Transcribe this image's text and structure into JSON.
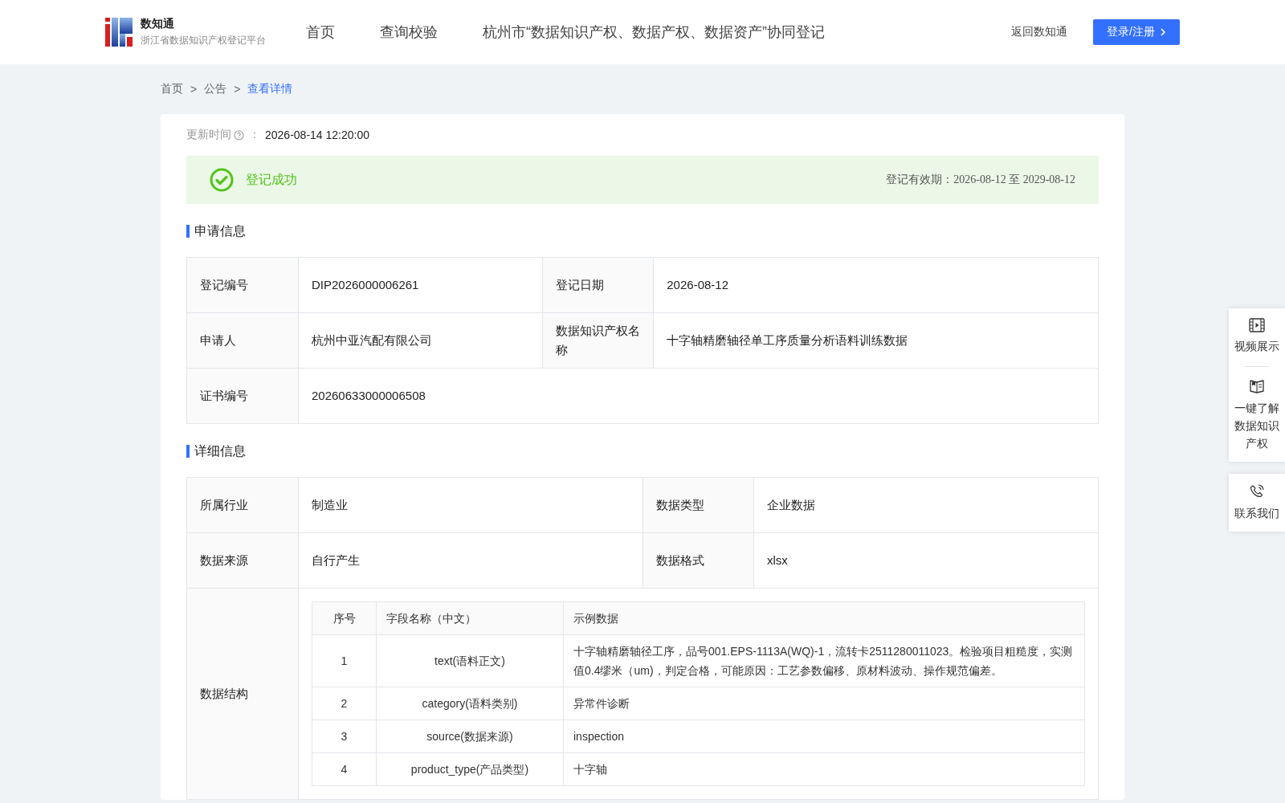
{
  "header": {
    "logo_title": "数知通",
    "logo_subtitle": "浙江省数据知识产权登记平台",
    "nav": [
      {
        "label": "首页",
        "selected": false
      },
      {
        "label": "查询校验",
        "selected": false
      },
      {
        "label": "杭州市“数据知识产权、数据产权、数据资产”协同登记",
        "selected": false
      }
    ],
    "back_link": "返回数知通",
    "login_button": "登录/注册"
  },
  "breadcrumb": [
    {
      "label": "首页",
      "selected": false
    },
    {
      "label": "公告",
      "selected": false
    },
    {
      "label": "查看详情",
      "selected": true
    }
  ],
  "breadcrumb_separator": ">",
  "update_time": {
    "label": "更新时间",
    "separator": "：",
    "value": "2026-08-14 12:20:00"
  },
  "status": {
    "kind": "success",
    "text": "登记成功",
    "validity": "登记有效期：2026-08-12 至 2029-08-12"
  },
  "application_info": {
    "title": "申请信息",
    "rows": [
      [
        {
          "label": "登记编号",
          "value": "DIP2026000006261"
        },
        {
          "label": "登记日期",
          "value": "2026-08-12"
        }
      ],
      [
        {
          "label": "申请人",
          "value": "杭州中亚汽配有限公司"
        },
        {
          "label": "数据知识产权名称",
          "value": "十字轴精磨轴径单工序质量分析语料训练数据"
        }
      ],
      [
        {
          "label": "证书编号",
          "value": "20260633000006508"
        }
      ]
    ]
  },
  "detail_info": {
    "title": "详细信息",
    "rows": [
      [
        {
          "label": "所属行业",
          "value": "制造业"
        },
        {
          "label": "数据类型",
          "value": "企业数据"
        }
      ],
      [
        {
          "label": "数据来源",
          "value": "自行产生"
        },
        {
          "label": "数据格式",
          "value": "xlsx"
        }
      ]
    ],
    "structure": {
      "label": "数据结构",
      "columns": [
        "序号",
        "字段名称（中文）",
        "示例数据"
      ],
      "rows": [
        [
          "1",
          "text(语料正文)",
          "十字轴精磨轴径工序，品号001.EPS-1113A(WQ)-1，流转卡2511280011023。检验项目粗糙度，实测值0.4缪米（um)，判定合格，可能原因：工艺参数偏移、原材料波动、操作规范偏差。"
        ],
        [
          "2",
          "category(语料类别)",
          "异常件诊断"
        ],
        [
          "3",
          "source(数据来源)",
          "inspection"
        ],
        [
          "4",
          "product_type(产品类型)",
          "十字轴"
        ]
      ]
    }
  },
  "side_panel": [
    {
      "kind": "video",
      "label": "视频展示"
    },
    {
      "kind": "book",
      "label": "一键了解数据知识产权"
    },
    {
      "kind": "phone",
      "label": "联系我们"
    }
  ]
}
